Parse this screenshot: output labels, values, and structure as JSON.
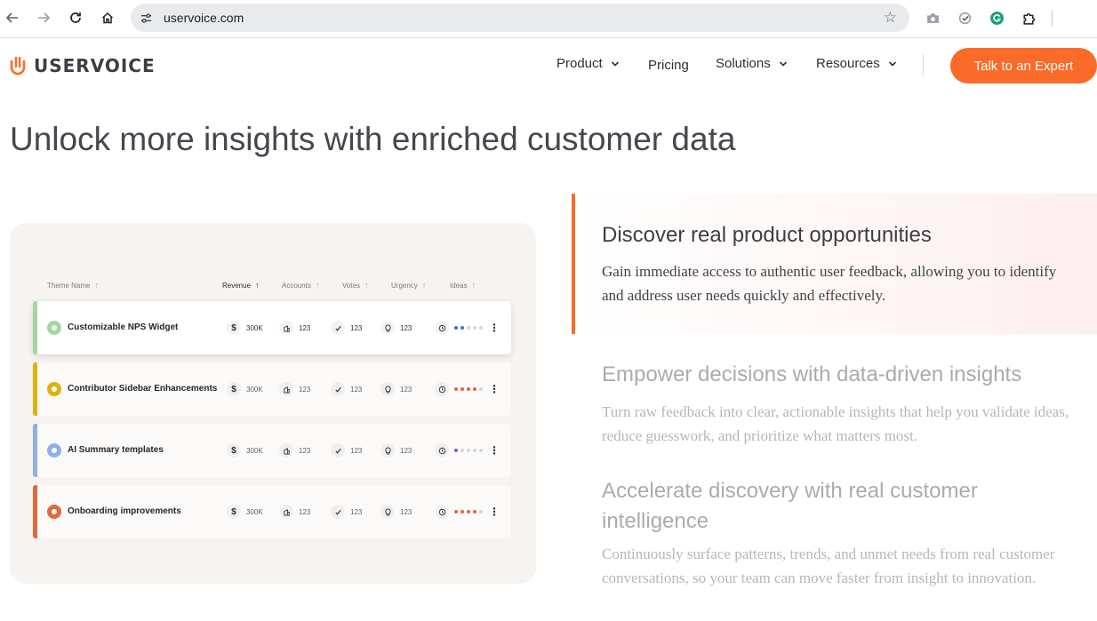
{
  "browser": {
    "url": "uservoice.com"
  },
  "header": {
    "logo_text": "USERVOICE",
    "nav": [
      {
        "label": "Product",
        "has_dropdown": true
      },
      {
        "label": "Pricing",
        "has_dropdown": false
      },
      {
        "label": "Solutions",
        "has_dropdown": true
      },
      {
        "label": "Resources",
        "has_dropdown": true
      }
    ],
    "cta_label": "Talk to an Expert"
  },
  "colors": {
    "accent": "#fa6a28",
    "card_background": "#f6f3f0"
  },
  "headline": "Unlock more insights with enriched customer data",
  "table": {
    "columns": [
      "Theme Name",
      "Revenue",
      "Accounts",
      "Votes",
      "Urgency",
      "Ideas"
    ],
    "sorted_column": "Revenue",
    "rows": [
      {
        "name": "Customizable NPS Widget",
        "revenue": "300K",
        "accounts": "123",
        "votes": "123",
        "urgency": "123",
        "color": "#a5d6a0",
        "ideas_color": "#3b6fd6",
        "ideas_filled": 2
      },
      {
        "name": "Contributor Sidebar Enhancements",
        "revenue": "300K",
        "accounts": "123",
        "votes": "123",
        "urgency": "123",
        "color": "#e0b10c",
        "ideas_color": "#e8633a",
        "ideas_filled": 4
      },
      {
        "name": "AI Summary templates",
        "revenue": "300K",
        "accounts": "123",
        "votes": "123",
        "urgency": "123",
        "color": "#8eb0e6",
        "ideas_color": "#7a5ccf",
        "ideas_filled": 1
      },
      {
        "name": "Onboarding improvements",
        "revenue": "300K",
        "accounts": "123",
        "votes": "123",
        "urgency": "123",
        "color": "#e0693e",
        "ideas_color": "#e8633a",
        "ideas_filled": 4
      }
    ]
  },
  "features": [
    {
      "title": "Discover real product opportunities",
      "body": "Gain immediate access to authentic user feedback, allowing you to identify and address user needs quickly and effectively.",
      "active": true
    },
    {
      "title": "Empower decisions with data-driven insights",
      "body": "Turn raw feedback into clear, actionable insights that help you validate ideas, reduce guesswork, and prioritize what matters most.",
      "active": false
    },
    {
      "title": "Accelerate discovery with real customer intelligence",
      "body": "Continuously surface patterns, trends, and unmet needs from real customer conversations, so your team can move faster from insight to innovation.",
      "active": false
    }
  ]
}
